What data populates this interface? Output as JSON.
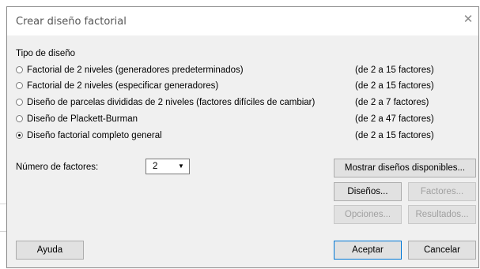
{
  "window": {
    "title": "Crear diseño factorial",
    "close_glyph": "✕"
  },
  "design_type": {
    "label": "Tipo de diseño",
    "options": [
      {
        "label": "Factorial de 2 niveles (generadores predeterminados)",
        "range": "(de 2 a 15 factores)",
        "selected": false
      },
      {
        "label": "Factorial de 2 niveles (especificar generadores)",
        "range": "(de 2 a 15 factores)",
        "selected": false
      },
      {
        "label": "Diseño de parcelas divididas de 2 niveles (factores difíciles de cambiar)",
        "range": "(de 2 a 7 factores)",
        "selected": false
      },
      {
        "label": "Diseño de Plackett-Burman",
        "range": "(de 2 a 47 factores)",
        "selected": false
      },
      {
        "label": "Diseño factorial completo general",
        "range": "(de 2 a 15 factores)",
        "selected": true
      }
    ]
  },
  "factors": {
    "label": "Número de factores:",
    "value": "2",
    "arrow": "▼"
  },
  "buttons": {
    "show_designs": "Mostrar diseños disponibles...",
    "designs": "Diseños...",
    "factors": "Factores...",
    "options": "Opciones...",
    "results": "Resultados...",
    "help": "Ayuda",
    "ok": "Aceptar",
    "cancel": "Cancelar"
  },
  "icons": {
    "close": "close-icon",
    "dropdown": "chevron-down-icon"
  }
}
